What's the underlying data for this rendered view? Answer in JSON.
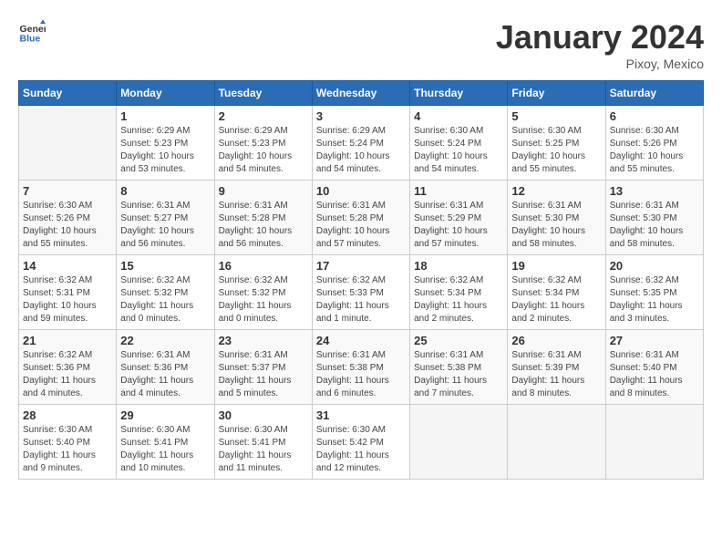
{
  "header": {
    "logo_general": "General",
    "logo_blue": "Blue",
    "month_title": "January 2024",
    "location": "Pixoy, Mexico"
  },
  "days_of_week": [
    "Sunday",
    "Monday",
    "Tuesday",
    "Wednesday",
    "Thursday",
    "Friday",
    "Saturday"
  ],
  "weeks": [
    [
      {
        "day": "",
        "info": ""
      },
      {
        "day": "1",
        "info": "Sunrise: 6:29 AM\nSunset: 5:23 PM\nDaylight: 10 hours\nand 53 minutes."
      },
      {
        "day": "2",
        "info": "Sunrise: 6:29 AM\nSunset: 5:23 PM\nDaylight: 10 hours\nand 54 minutes."
      },
      {
        "day": "3",
        "info": "Sunrise: 6:29 AM\nSunset: 5:24 PM\nDaylight: 10 hours\nand 54 minutes."
      },
      {
        "day": "4",
        "info": "Sunrise: 6:30 AM\nSunset: 5:24 PM\nDaylight: 10 hours\nand 54 minutes."
      },
      {
        "day": "5",
        "info": "Sunrise: 6:30 AM\nSunset: 5:25 PM\nDaylight: 10 hours\nand 55 minutes."
      },
      {
        "day": "6",
        "info": "Sunrise: 6:30 AM\nSunset: 5:26 PM\nDaylight: 10 hours\nand 55 minutes."
      }
    ],
    [
      {
        "day": "7",
        "info": "Sunrise: 6:30 AM\nSunset: 5:26 PM\nDaylight: 10 hours\nand 55 minutes."
      },
      {
        "day": "8",
        "info": "Sunrise: 6:31 AM\nSunset: 5:27 PM\nDaylight: 10 hours\nand 56 minutes."
      },
      {
        "day": "9",
        "info": "Sunrise: 6:31 AM\nSunset: 5:28 PM\nDaylight: 10 hours\nand 56 minutes."
      },
      {
        "day": "10",
        "info": "Sunrise: 6:31 AM\nSunset: 5:28 PM\nDaylight: 10 hours\nand 57 minutes."
      },
      {
        "day": "11",
        "info": "Sunrise: 6:31 AM\nSunset: 5:29 PM\nDaylight: 10 hours\nand 57 minutes."
      },
      {
        "day": "12",
        "info": "Sunrise: 6:31 AM\nSunset: 5:30 PM\nDaylight: 10 hours\nand 58 minutes."
      },
      {
        "day": "13",
        "info": "Sunrise: 6:31 AM\nSunset: 5:30 PM\nDaylight: 10 hours\nand 58 minutes."
      }
    ],
    [
      {
        "day": "14",
        "info": "Sunrise: 6:32 AM\nSunset: 5:31 PM\nDaylight: 10 hours\nand 59 minutes."
      },
      {
        "day": "15",
        "info": "Sunrise: 6:32 AM\nSunset: 5:32 PM\nDaylight: 11 hours\nand 0 minutes."
      },
      {
        "day": "16",
        "info": "Sunrise: 6:32 AM\nSunset: 5:32 PM\nDaylight: 11 hours\nand 0 minutes."
      },
      {
        "day": "17",
        "info": "Sunrise: 6:32 AM\nSunset: 5:33 PM\nDaylight: 11 hours\nand 1 minute."
      },
      {
        "day": "18",
        "info": "Sunrise: 6:32 AM\nSunset: 5:34 PM\nDaylight: 11 hours\nand 2 minutes."
      },
      {
        "day": "19",
        "info": "Sunrise: 6:32 AM\nSunset: 5:34 PM\nDaylight: 11 hours\nand 2 minutes."
      },
      {
        "day": "20",
        "info": "Sunrise: 6:32 AM\nSunset: 5:35 PM\nDaylight: 11 hours\nand 3 minutes."
      }
    ],
    [
      {
        "day": "21",
        "info": "Sunrise: 6:32 AM\nSunset: 5:36 PM\nDaylight: 11 hours\nand 4 minutes."
      },
      {
        "day": "22",
        "info": "Sunrise: 6:31 AM\nSunset: 5:36 PM\nDaylight: 11 hours\nand 4 minutes."
      },
      {
        "day": "23",
        "info": "Sunrise: 6:31 AM\nSunset: 5:37 PM\nDaylight: 11 hours\nand 5 minutes."
      },
      {
        "day": "24",
        "info": "Sunrise: 6:31 AM\nSunset: 5:38 PM\nDaylight: 11 hours\nand 6 minutes."
      },
      {
        "day": "25",
        "info": "Sunrise: 6:31 AM\nSunset: 5:38 PM\nDaylight: 11 hours\nand 7 minutes."
      },
      {
        "day": "26",
        "info": "Sunrise: 6:31 AM\nSunset: 5:39 PM\nDaylight: 11 hours\nand 8 minutes."
      },
      {
        "day": "27",
        "info": "Sunrise: 6:31 AM\nSunset: 5:40 PM\nDaylight: 11 hours\nand 8 minutes."
      }
    ],
    [
      {
        "day": "28",
        "info": "Sunrise: 6:30 AM\nSunset: 5:40 PM\nDaylight: 11 hours\nand 9 minutes."
      },
      {
        "day": "29",
        "info": "Sunrise: 6:30 AM\nSunset: 5:41 PM\nDaylight: 11 hours\nand 10 minutes."
      },
      {
        "day": "30",
        "info": "Sunrise: 6:30 AM\nSunset: 5:41 PM\nDaylight: 11 hours\nand 11 minutes."
      },
      {
        "day": "31",
        "info": "Sunrise: 6:30 AM\nSunset: 5:42 PM\nDaylight: 11 hours\nand 12 minutes."
      },
      {
        "day": "",
        "info": ""
      },
      {
        "day": "",
        "info": ""
      },
      {
        "day": "",
        "info": ""
      }
    ]
  ]
}
